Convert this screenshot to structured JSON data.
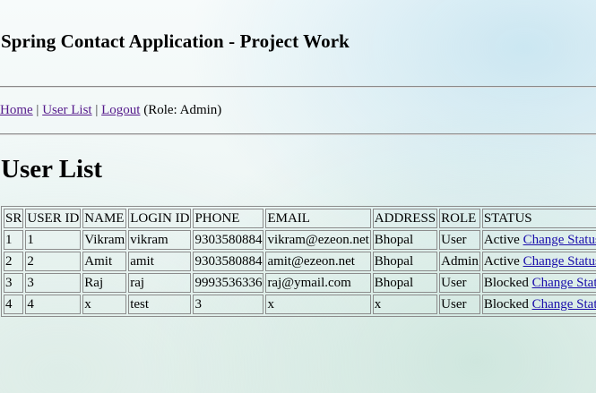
{
  "header": {
    "title": "Spring Contact Application - Project Work"
  },
  "nav": {
    "links": [
      {
        "label": "Home"
      },
      {
        "label": "User List"
      },
      {
        "label": "Logout"
      }
    ],
    "separator": "|",
    "role_text": "(Role: Admin)"
  },
  "main": {
    "title": "User List",
    "table": {
      "headers": [
        "SR",
        "USER ID",
        "NAME",
        "LOGIN ID",
        "PHONE",
        "EMAIL",
        "ADDRESS",
        "ROLE",
        "STATUS"
      ],
      "rows": [
        {
          "sr": "1",
          "user_id": "1",
          "name": "Vikram",
          "login_id": "vikram",
          "phone": "9303580884",
          "email": "vikram@ezeon.net",
          "address": "Bhopal",
          "role": "User",
          "status": "Active",
          "action": "Change Status"
        },
        {
          "sr": "2",
          "user_id": "2",
          "name": "Amit",
          "login_id": "amit",
          "phone": "9303580884",
          "email": "amit@ezeon.net",
          "address": "Bhopal",
          "role": "Admin",
          "status": "Active",
          "action": "Change Status"
        },
        {
          "sr": "3",
          "user_id": "3",
          "name": "Raj",
          "login_id": "raj",
          "phone": "9993536336",
          "email": "raj@ymail.com",
          "address": "Bhopal",
          "role": "User",
          "status": "Blocked",
          "action": "Change Status"
        },
        {
          "sr": "4",
          "user_id": "4",
          "name": "x",
          "login_id": "test",
          "phone": "3",
          "email": "x",
          "address": "x",
          "role": "User",
          "status": "Blocked",
          "action": "Change Status"
        }
      ]
    }
  },
  "colors": {
    "link": "#1a0dab",
    "visited_link": "#551a8b",
    "border": "#8c8c8c"
  }
}
